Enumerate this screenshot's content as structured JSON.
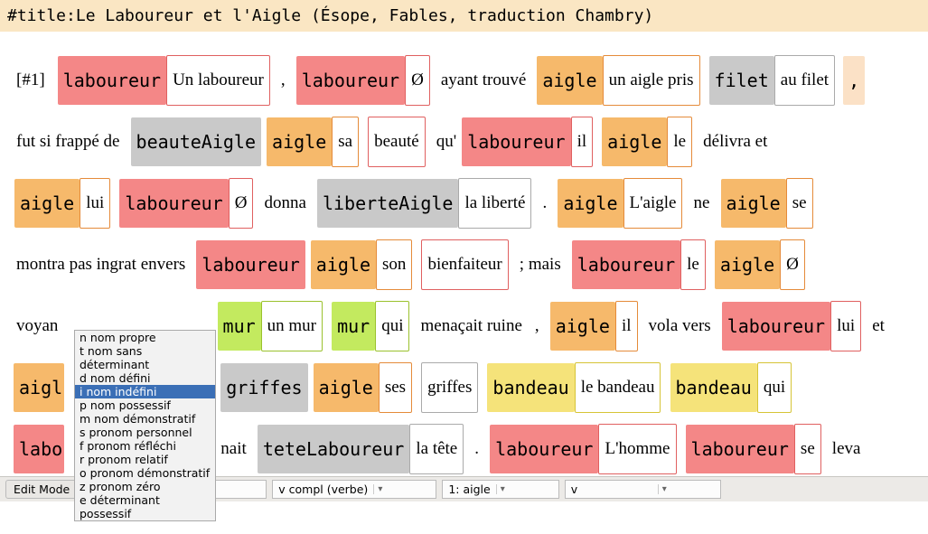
{
  "title": "#title:Le Laboureur et l'Aigle (Ésope, Fables, traduction Chambry)",
  "popup": {
    "items": [
      "n nom propre",
      "t nom sans déterminant",
      "d nom défini",
      "i nom indéfini",
      "p nom possessif",
      "m nom démonstratif",
      "s pronom personnel",
      "f pronom réfléchi",
      "r pronom relatif",
      "o pronom démonstratif",
      "z pronom zéro",
      "e déterminant possessif"
    ],
    "selected_index": 3
  },
  "bottom": {
    "button": "Edit Mode",
    "sel1": "i nom indéfini",
    "sel2": "v compl (verbe)",
    "sel3": "1: aigle",
    "sel4": "v"
  },
  "tokens": {
    "id1": "[#1]",
    "laboureur": "laboureur",
    "un_laboureur": "Un laboureur",
    "comma": ",",
    "zero": "Ø",
    "ayant_trouve": "ayant trouvé",
    "aigle": "aigle",
    "un_aigle_pris": "un aigle pris",
    "filet": "filet",
    "au_filet": "au filet",
    "fut_si_frappe_de": "fut si frappé de",
    "beauteAigle": "beauteAigle",
    "sa": "sa",
    "beaute": "beauté",
    "qu": "qu'",
    "il": "il",
    "le": "le",
    "delivra_et": "délivra et",
    "lui": "lui",
    "donna": "donna",
    "liberteAigle": "liberteAigle",
    "la_liberte": "la liberté",
    "dot": ".",
    "Laigle": "L'aigle",
    "ne": "ne",
    "se": "se",
    "montra_pas": "montra pas ingrat envers",
    "son": "son",
    "bienfaiteur": "bienfaiteur",
    "semimais": "; mais",
    "voyan": "voyan",
    "mur": "mur",
    "un_mur": "un mur",
    "qui": "qui",
    "menacait_ruine": "menaçait ruine",
    "vola_vers": "vola vers",
    "et": "et",
    "aigl": "aigl",
    "griffes": "griffes",
    "ses": "ses",
    "bandeau": "bandeau",
    "le_bandeau": "le bandeau",
    "labo": "labo",
    "nait": "nait",
    "teteLaboureur": "teteLaboureur",
    "la_tete": "la tête",
    "Lhomme": "L'homme",
    "leva": "leva"
  }
}
